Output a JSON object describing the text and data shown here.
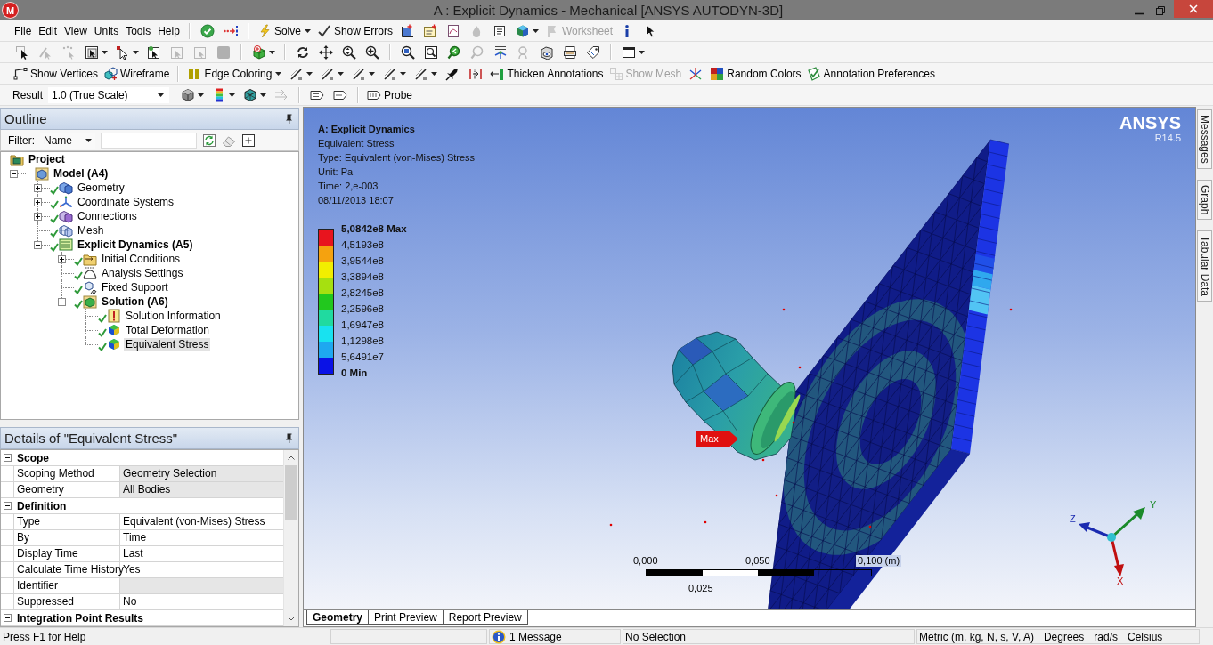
{
  "window": {
    "icon_letter": "M",
    "title": "A : Explicit Dynamics - Mechanical [ANSYS AUTODYN-3D]"
  },
  "menu": [
    "File",
    "Edit",
    "View",
    "Units",
    "Tools",
    "Help"
  ],
  "standard_toolbar": [
    {
      "label": "Solve",
      "dropdown": true,
      "disabled": false
    },
    {
      "label": "Show Errors",
      "dropdown": false,
      "disabled": false
    },
    {
      "label": "Worksheet",
      "dropdown": false,
      "disabled": true
    }
  ],
  "annotation_toolbar": [
    {
      "label": "Show Vertices",
      "dropdown": false,
      "disabled": false
    },
    {
      "label": "Wireframe",
      "dropdown": false,
      "disabled": false
    },
    {
      "label": "Edge Coloring",
      "dropdown": true,
      "disabled": false
    },
    {
      "label": "Thicken Annotations",
      "dropdown": false,
      "disabled": false
    },
    {
      "label": "Show Mesh",
      "dropdown": false,
      "disabled": true
    },
    {
      "label": "Random Colors",
      "dropdown": false,
      "disabled": false
    },
    {
      "label": "Annotation Preferences",
      "dropdown": false,
      "disabled": false
    }
  ],
  "result_toolbar": {
    "label": "Result",
    "scale": "1.0 (True Scale)",
    "probe": "Probe"
  },
  "outline": {
    "title": "Outline",
    "filter_label": "Filter:",
    "filter_by": "Name",
    "tree": [
      {
        "label": "Project",
        "kind": "project",
        "ok": false,
        "selected": false,
        "children": [
          {
            "label": "Model (A4)",
            "kind": "model",
            "expanded": true,
            "ok": false,
            "selected": false,
            "children": [
              {
                "label": "Geometry",
                "kind": "geometry",
                "expanded": false,
                "ok": true,
                "selected": false
              },
              {
                "label": "Coordinate Systems",
                "kind": "coordinates",
                "expanded": false,
                "ok": true,
                "selected": false
              },
              {
                "label": "Connections",
                "kind": "connections",
                "expanded": false,
                "ok": true,
                "selected": false
              },
              {
                "label": "Mesh",
                "kind": "mesh",
                "ok": true,
                "selected": false
              },
              {
                "label": "Explicit Dynamics (A5)",
                "kind": "analysis",
                "expanded": true,
                "ok": true,
                "selected": false,
                "children": [
                  {
                    "label": "Initial Conditions",
                    "kind": "initial",
                    "expanded": false,
                    "ok": true,
                    "selected": false
                  },
                  {
                    "label": "Analysis Settings",
                    "kind": "settings",
                    "ok": true,
                    "selected": false
                  },
                  {
                    "label": "Fixed Support",
                    "kind": "support",
                    "ok": true,
                    "selected": false
                  },
                  {
                    "label": "Solution (A6)",
                    "kind": "solution",
                    "expanded": true,
                    "ok": true,
                    "selected": false,
                    "children": [
                      {
                        "label": "Solution Information",
                        "kind": "information",
                        "ok": true,
                        "selected": false
                      },
                      {
                        "label": "Total Deformation",
                        "kind": "result",
                        "ok": true,
                        "selected": false
                      },
                      {
                        "label": "Equivalent Stress",
                        "kind": "result",
                        "ok": true,
                        "selected": true
                      }
                    ]
                  }
                ]
              }
            ]
          }
        ]
      }
    ]
  },
  "details": {
    "title": "Details of \"Equivalent Stress\"",
    "groups": [
      {
        "name": "Scope",
        "expanded": true,
        "rows": [
          {
            "name": "Scoping Method",
            "value": "Geometry Selection",
            "readonly": true
          },
          {
            "name": "Geometry",
            "value": "All Bodies",
            "readonly": true
          }
        ]
      },
      {
        "name": "Definition",
        "expanded": true,
        "rows": [
          {
            "name": "Type",
            "value": "Equivalent (von-Mises) Stress",
            "readonly": false
          },
          {
            "name": "By",
            "value": "Time",
            "readonly": false
          },
          {
            "name": "Display Time",
            "value": "Last",
            "readonly": false
          },
          {
            "name": "Calculate Time History",
            "value": "Yes",
            "readonly": false
          },
          {
            "name": "Identifier",
            "readonly": true
          },
          {
            "name": "Suppressed",
            "value": "No",
            "readonly": false
          }
        ]
      },
      {
        "name": "Integration Point Results",
        "expanded": true
      }
    ]
  },
  "viewport": {
    "logo": "ANSYS",
    "version": "R14.5",
    "title": "A: Explicit Dynamics",
    "info": [
      "Equivalent Stress",
      "Type: Equivalent (von-Mises) Stress",
      "Unit: Pa",
      "Time: 2,e-003",
      "08/11/2013 18:07"
    ],
    "legend": {
      "labels": [
        {
          "text": "5,0842e8 Max",
          "kind": "extreme"
        },
        {
          "text": "4,5193e8",
          "kind": "value"
        },
        {
          "text": "3,9544e8",
          "kind": "value"
        },
        {
          "text": "3,3894e8",
          "kind": "value"
        },
        {
          "text": "2,8245e8",
          "kind": "value"
        },
        {
          "text": "2,2596e8",
          "kind": "value"
        },
        {
          "text": "1,6947e8",
          "kind": "value"
        },
        {
          "text": "1,1298e8",
          "kind": "value"
        },
        {
          "text": "5,6491e7",
          "kind": "value"
        },
        {
          "text": "0 Min",
          "kind": "extreme"
        }
      ],
      "bands": [
        {
          "color": "#e8141e"
        },
        {
          "color": "#f5a20f"
        },
        {
          "color": "#f2ee00"
        },
        {
          "color": "#a6e010"
        },
        {
          "color": "#22c81e"
        },
        {
          "color": "#20daa0"
        },
        {
          "color": "#18e2f0"
        },
        {
          "color": "#1ea8f0"
        },
        {
          "color": "#0a12e6"
        }
      ]
    },
    "probe": "Max",
    "scale_bar": {
      "labels": [
        "0,000",
        "0,050",
        "0,100 (m)"
      ],
      "midpoint": "0,025"
    },
    "triad": {
      "x": "X",
      "y": "Y",
      "z": "Z"
    },
    "tabs": [
      {
        "label": "Geometry",
        "selected": true
      },
      {
        "label": "Print Preview",
        "selected": false
      },
      {
        "label": "Report Preview",
        "selected": false
      }
    ]
  },
  "side_tabs": [
    "Messages",
    "Graph",
    "Tabular Data"
  ],
  "status_bar": {
    "help": "Press F1 for Help",
    "messages": "1 Message",
    "selection": "No Selection",
    "units": "Metric (m, kg, N, s, V, A)",
    "angle": "Degrees",
    "rotation": "rad/s",
    "temperature": "Celsius"
  }
}
